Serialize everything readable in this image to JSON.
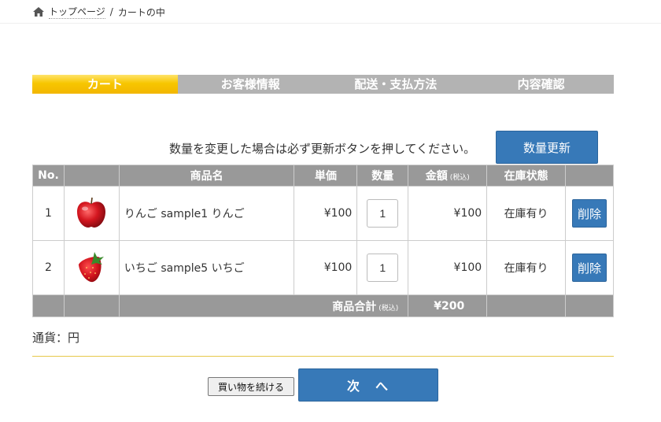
{
  "breadcrumb": {
    "home": "トップページ",
    "separator": "/",
    "current": "カートの中"
  },
  "steps": [
    "カート",
    "お客様情報",
    "配送・支払方法",
    "内容確認"
  ],
  "notice": "数量を変更した場合は必ず更新ボタンを押してください。",
  "update_button": "数量更新",
  "table": {
    "headers": {
      "no": "No.",
      "image": "",
      "name": "商品名",
      "price": "単価",
      "qty": "数量",
      "amount": "金額",
      "amount_tax": "(税込)",
      "stock": "在庫状態",
      "action": ""
    },
    "rows": [
      {
        "no": "1",
        "image_icon": "apple-icon",
        "name": "りんご sample1 りんご",
        "price": "¥100",
        "qty": "1",
        "amount": "¥100",
        "stock": "在庫有り",
        "delete": "削除"
      },
      {
        "no": "2",
        "image_icon": "strawberry-icon",
        "name": "いちご sample5 いちご",
        "price": "¥100",
        "qty": "1",
        "amount": "¥100",
        "stock": "在庫有り",
        "delete": "削除"
      }
    ],
    "footer": {
      "label": "商品合計",
      "tax": "(税込)",
      "total": "¥200"
    }
  },
  "currency": "通貨：円",
  "continue_button": "買い物を続ける",
  "next_button": "次　へ",
  "colors": {
    "accent": "#3779b8",
    "step_active": "#f7c600",
    "header_bg": "#999999",
    "step_bg": "#b3b3b3"
  }
}
